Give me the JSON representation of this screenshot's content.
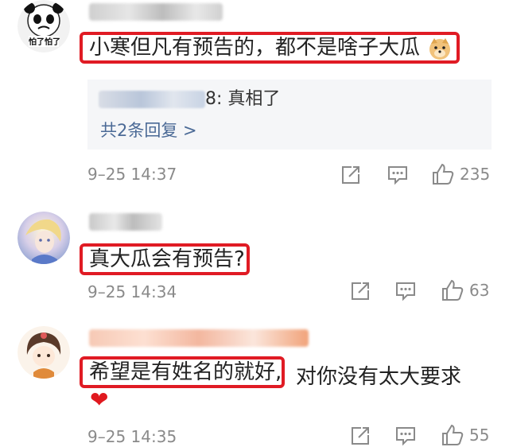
{
  "comments": [
    {
      "avatar_caption": "怕了怕了",
      "text": "小寒但凡有预告的，都不是啥子大瓜",
      "reply": {
        "suffix": "8: 真相了",
        "more": "共2条回复 >"
      },
      "time": "9–25 14:37",
      "likes": "235"
    },
    {
      "text": "真大瓜会有预告?",
      "time": "9–25 14:34",
      "likes": "63"
    },
    {
      "text": "希望是有姓名的就好,",
      "extra": "对你没有太大要求",
      "heart": "❤",
      "time": "9–25 14:35",
      "likes": "55"
    }
  ]
}
